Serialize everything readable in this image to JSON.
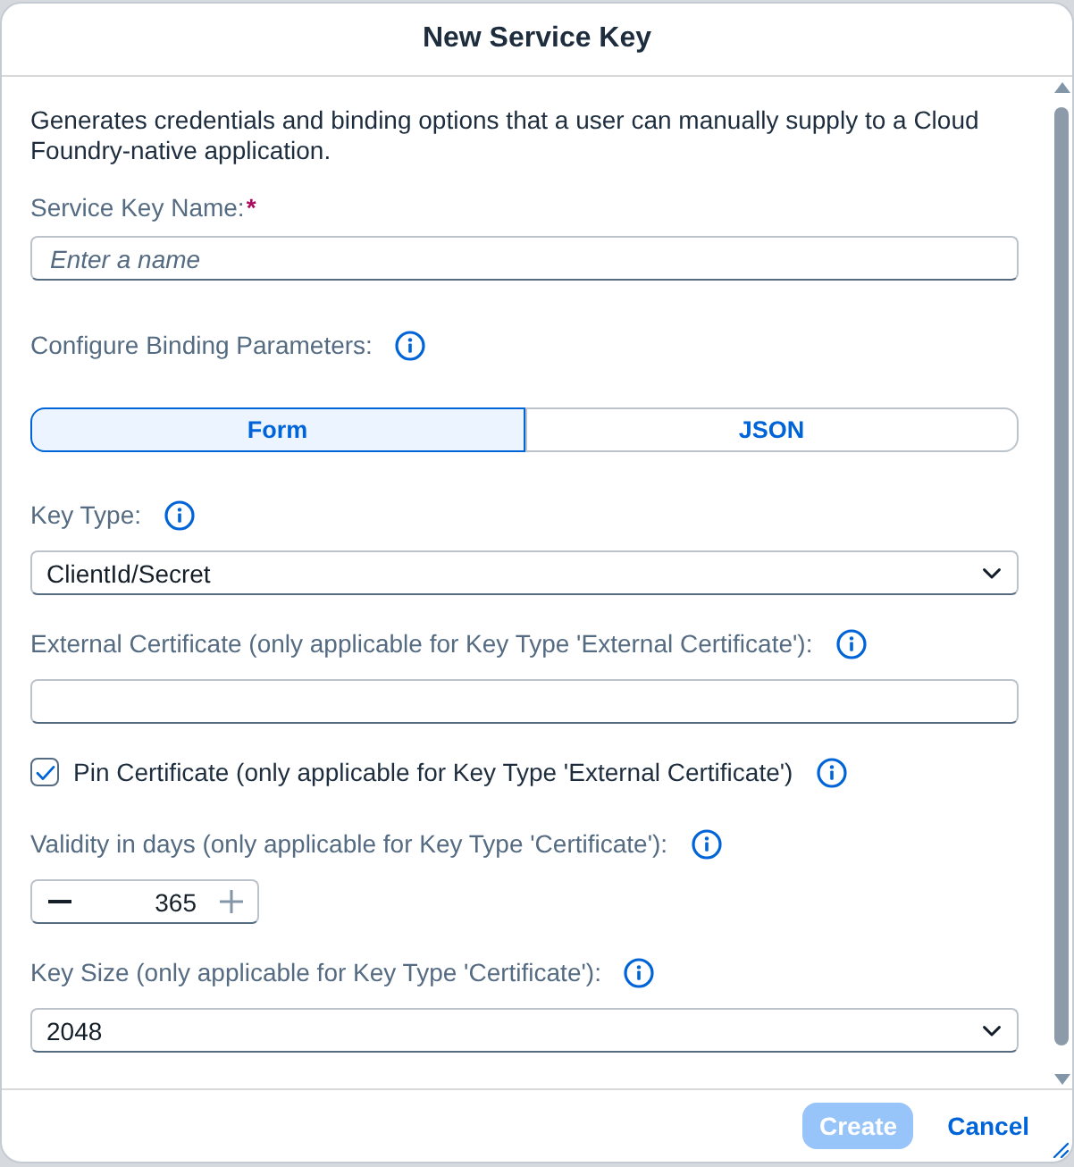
{
  "dialog": {
    "title": "New Service Key"
  },
  "description": "Generates credentials and binding options that a user can manually supply to a Cloud Foundry-native application.",
  "fields": [
    {
      "kind": "text",
      "label": "Service Key Name:",
      "required_mark": "*",
      "placeholder": "Enter a name"
    },
    {
      "kind": "segmented",
      "label": "Configure Binding Parameters:",
      "info": true,
      "options": [
        {
          "label": "Form",
          "selected": true
        },
        {
          "label": "JSON",
          "selected": false
        }
      ]
    },
    {
      "kind": "select",
      "label": "Key Type:",
      "info": true,
      "value": "ClientId/Secret"
    },
    {
      "kind": "text",
      "label": "External Certificate (only applicable for Key Type 'External Certificate'):",
      "info": true
    },
    {
      "kind": "checkbox",
      "label": "Pin Certificate (only applicable for Key Type 'External Certificate')",
      "info": true,
      "checked": true
    },
    {
      "kind": "stepper",
      "label": "Validity in days (only applicable for Key Type 'Certificate'):",
      "info": true,
      "value": "365",
      "decrement_disabled": false,
      "increment_disabled": true
    },
    {
      "kind": "select",
      "label": "Key Size (only applicable for Key Type 'Certificate'):",
      "info": true,
      "value": "2048"
    }
  ],
  "buttons": [
    {
      "label": "Create",
      "kind": "emphasized",
      "disabled": true
    },
    {
      "label": "Cancel",
      "kind": "transparent",
      "disabled": false
    }
  ]
}
